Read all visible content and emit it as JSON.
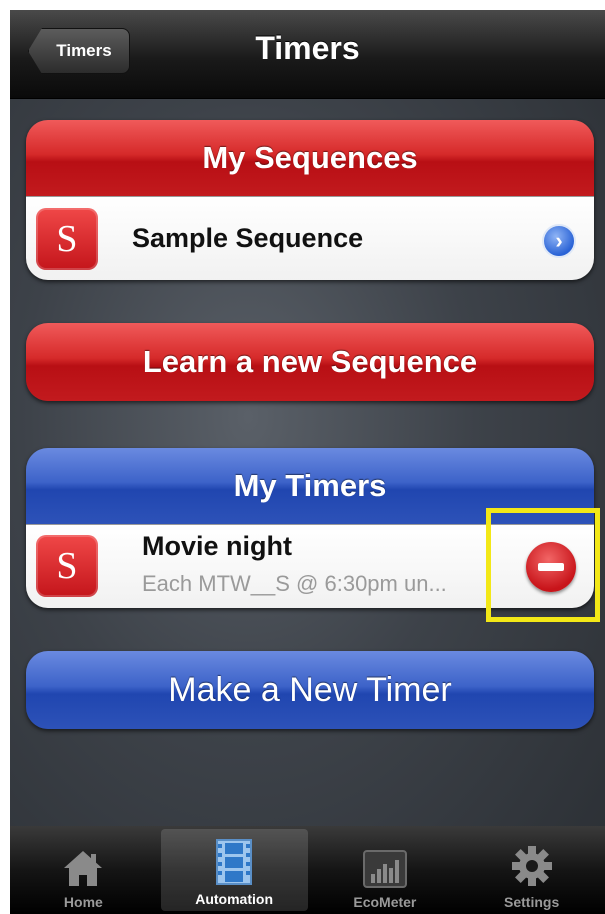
{
  "nav": {
    "back_label": "Timers",
    "title": "Timers"
  },
  "sequences": {
    "header": "My Sequences",
    "items": [
      {
        "badge": "S",
        "title": "Sample Sequence",
        "icon": "disclosure-arrow-icon"
      }
    ]
  },
  "learn_button": "Learn a new Sequence",
  "timers": {
    "header": "My Timers",
    "items": [
      {
        "badge": "S",
        "title": "Movie night",
        "subtitle": "Each MTW__S @ 6:30pm un...",
        "icon": "delete-minus-icon"
      }
    ]
  },
  "make_button": "Make a New Timer",
  "tabbar": {
    "active": "Automation",
    "tabs": [
      {
        "label": "Home",
        "icon": "home-icon"
      },
      {
        "label": "Automation",
        "icon": "film-icon"
      },
      {
        "label": "EcoMeter",
        "icon": "bar-meter-icon"
      },
      {
        "label": "Settings",
        "icon": "gear-icon"
      }
    ]
  },
  "colors": {
    "red_accent": "#c21a1e",
    "blue_accent": "#2d52b8",
    "highlight": "#f3e817",
    "background": "#3d4249"
  }
}
